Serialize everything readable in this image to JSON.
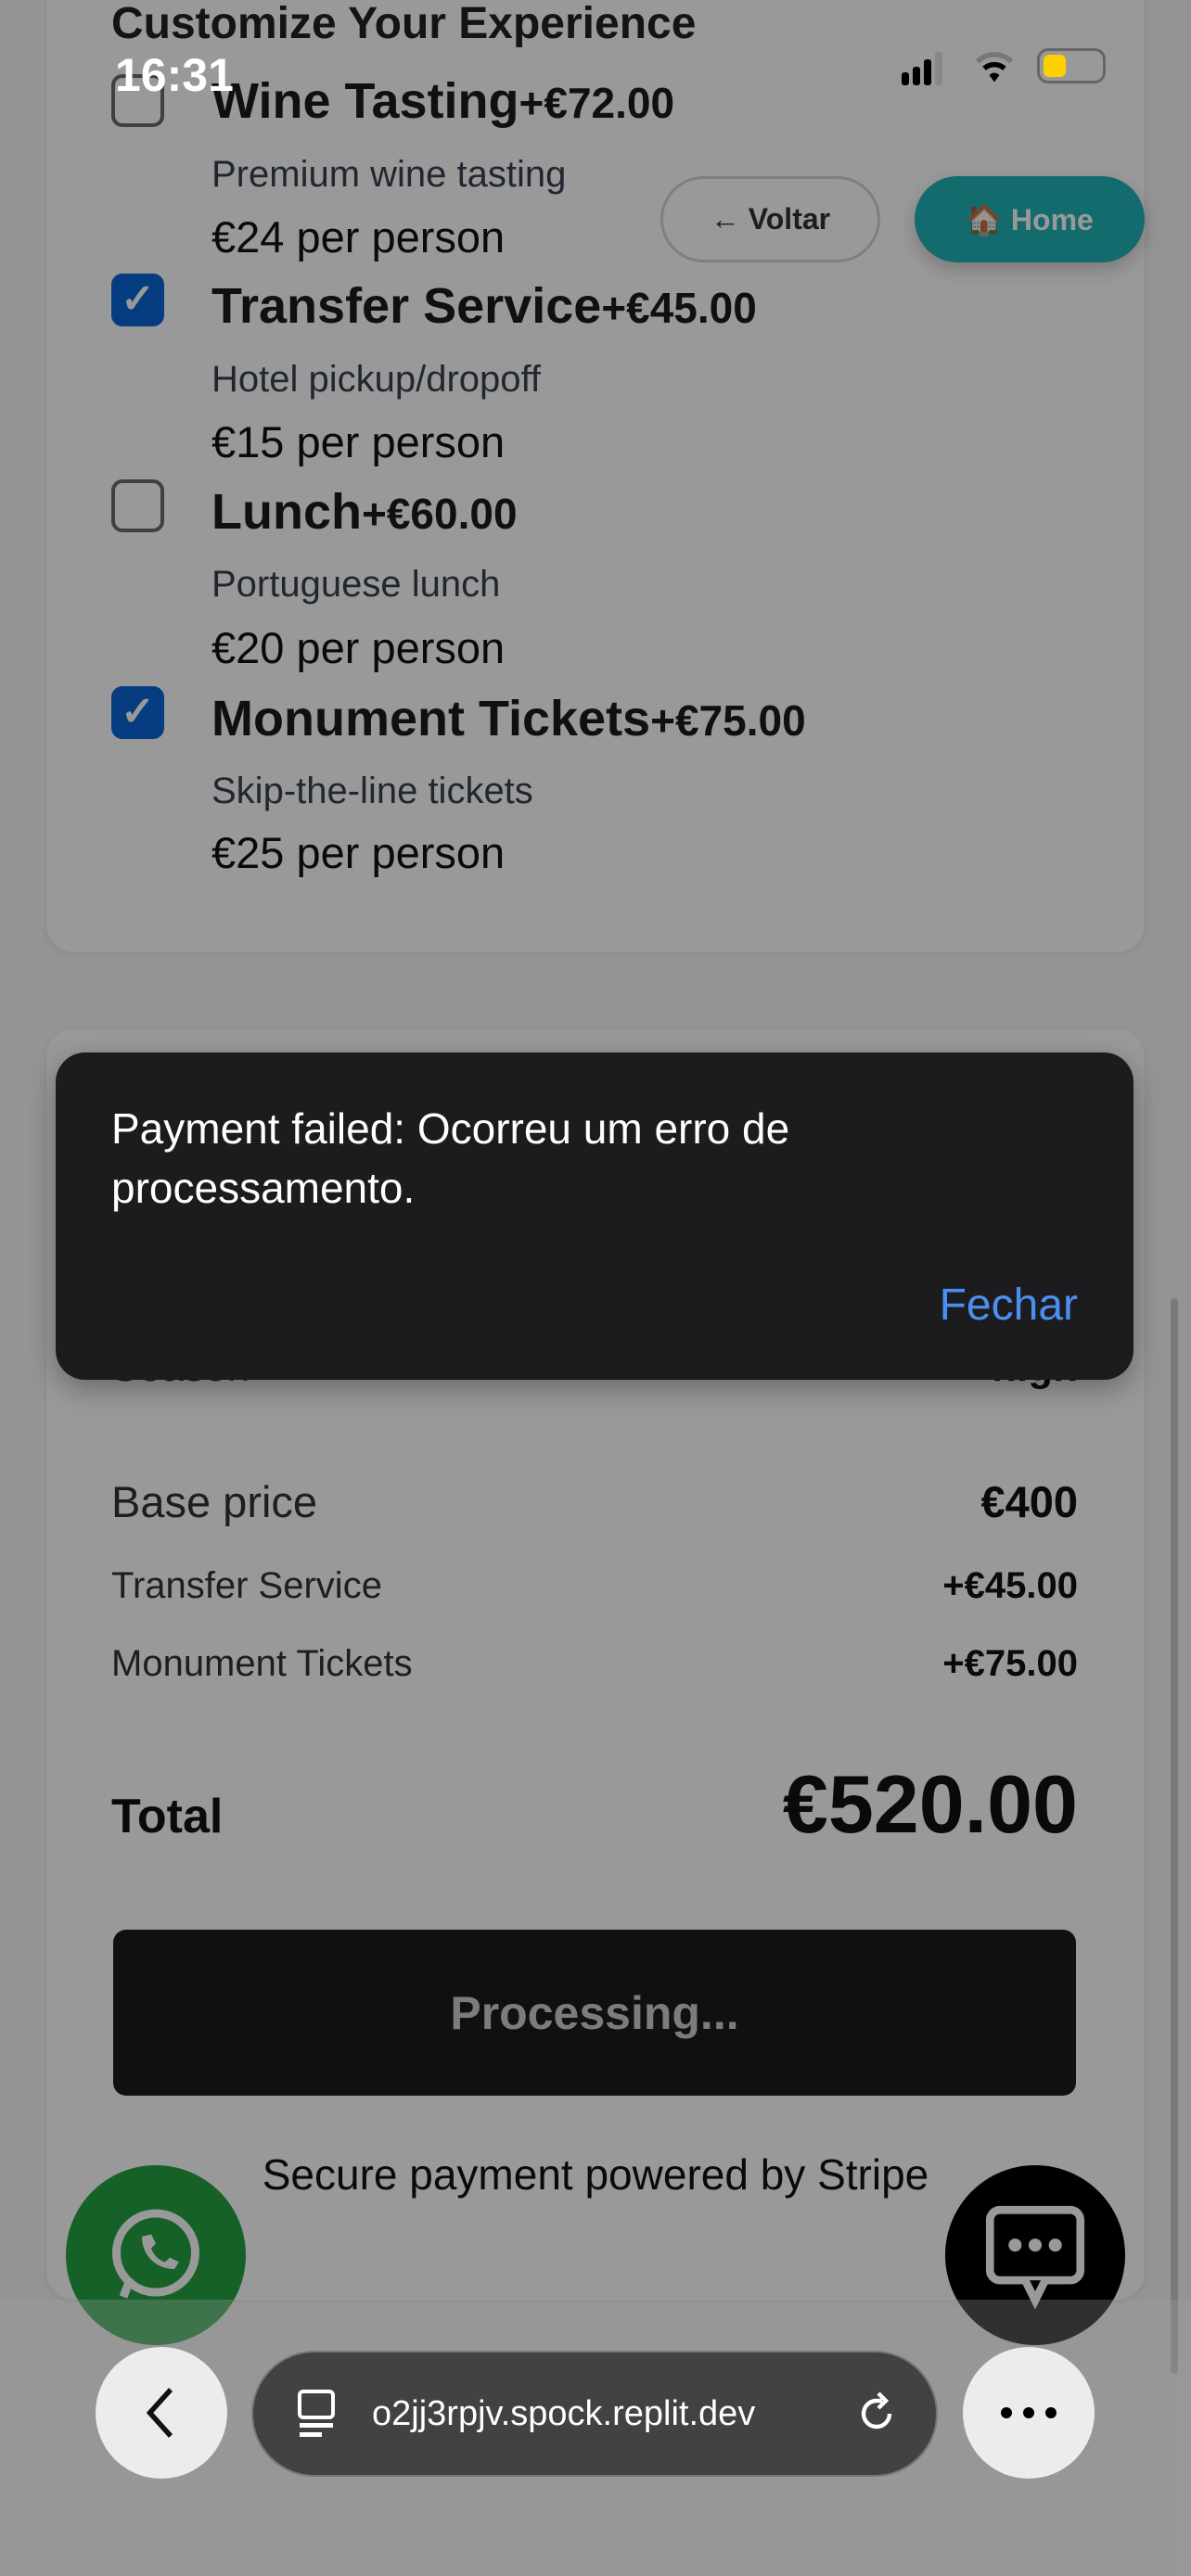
{
  "status_bar": {
    "time": "16:31"
  },
  "section_title": "Customize Your Experience",
  "nav": {
    "back_label": "← Voltar",
    "home_label": "🏠 Home"
  },
  "options": [
    {
      "title": "Wine Tasting",
      "price": "+€72.00",
      "desc": "Premium wine tasting",
      "per_person": "€24 per person",
      "checked": false
    },
    {
      "title": "Transfer Service",
      "price": "+€45.00",
      "desc": "Hotel pickup/dropoff",
      "per_person": "€15 per person",
      "checked": true
    },
    {
      "title": "Lunch",
      "price": "+€60.00",
      "desc": "Portuguese lunch",
      "per_person": "€20 per person",
      "checked": false
    },
    {
      "title": "Monument Tickets",
      "price": "+€75.00",
      "desc": "Skip-the-line tickets",
      "per_person": "€25 per person",
      "checked": true
    }
  ],
  "summary": {
    "season_label": "Season",
    "season_value": "high",
    "base_label": "Base price",
    "base_value": "€400",
    "extras": [
      {
        "label": "Transfer Service",
        "value": "+€45.00"
      },
      {
        "label": "Monument Tickets",
        "value": "+€75.00"
      }
    ],
    "total_label": "Total",
    "total_value": "€520.00"
  },
  "pay_button": "Processing...",
  "secure_text": "Secure payment powered by Stripe",
  "toast": {
    "message": "Payment failed: Ocorreu um erro de processamento.",
    "close_label": "Fechar"
  },
  "browser": {
    "url": "o2jj3rpjv.spock.replit.dev"
  },
  "colors": {
    "checkbox": "#0a66d8",
    "home": "#20b2b8",
    "whatsapp": "#25a244",
    "link": "#4a90f0"
  }
}
